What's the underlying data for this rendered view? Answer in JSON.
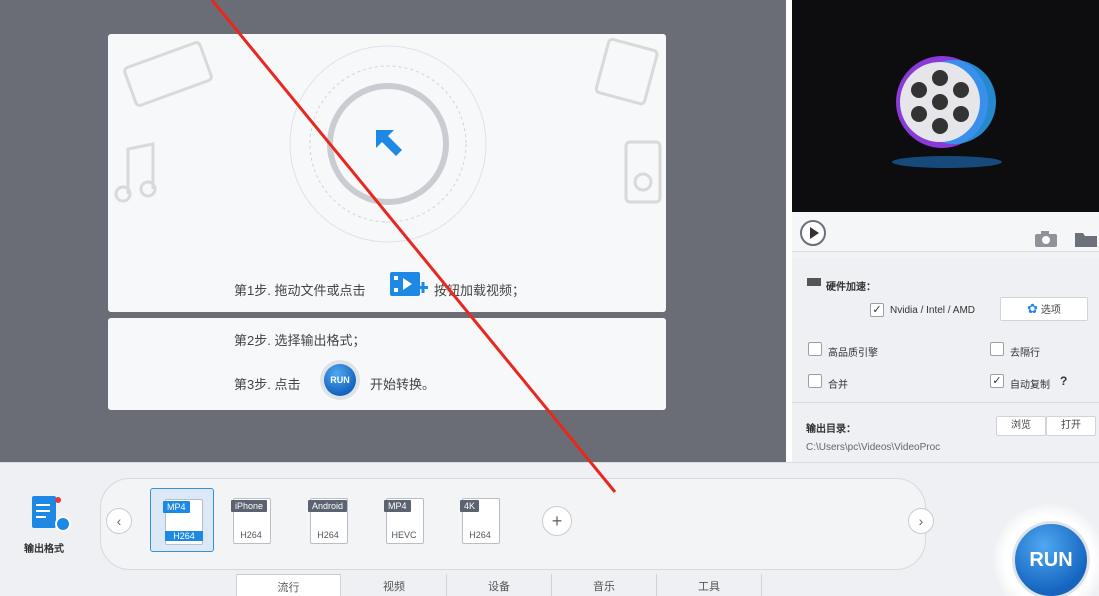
{
  "drop_area": {
    "step1_prefix": "第1步. 拖动文件或点击",
    "step1_suffix": "按钮加载视频；",
    "step2": "第2步. 选择输出格式；",
    "step3_prefix": "第3步. 点击",
    "step3_suffix": "开始转换。",
    "run_small_label": "RUN"
  },
  "preview": {
    "play_icon": "play-icon",
    "snapshot_icon": "camera-icon",
    "folder_icon": "folder-icon"
  },
  "settings": {
    "hw_accel_label": "硬件加速：",
    "hw_accel_option": "Nvidia / Intel / AMD",
    "hw_accel_checked": true,
    "options_button": "选项",
    "high_quality_label": "高品质引擎",
    "high_quality_checked": false,
    "deinterlace_label": "去隔行",
    "deinterlace_checked": false,
    "merge_label": "合并",
    "merge_checked": false,
    "auto_copy_label": "自动复制",
    "auto_copy_checked": true,
    "auto_copy_help": "?",
    "output_dir_label": "输出目录：",
    "output_path": "C:\\Users\\pc\\Videos\\VideoProc",
    "browse_button": "浏览",
    "open_button": "打开"
  },
  "bottom": {
    "output_format_label": "输出格式",
    "formats": [
      {
        "tag": "MP4",
        "codec": "H264",
        "selected": true
      },
      {
        "tag": "iPhone",
        "codec": "H264",
        "selected": false
      },
      {
        "tag": "Android",
        "codec": "H264",
        "selected": false
      },
      {
        "tag": "MP4",
        "codec": "HEVC",
        "selected": false
      },
      {
        "tag": "4K",
        "codec": "H264",
        "selected": false
      }
    ],
    "add_label": "+",
    "prev_arrow": "‹",
    "next_arrow": "›",
    "tabs": [
      "流行",
      "视频",
      "设备",
      "音乐",
      "工具"
    ],
    "active_tab": "流行",
    "run_label": "RUN"
  },
  "colors": {
    "accent": "#1e88e5",
    "annotation_red": "#e8281e",
    "drop_bg": "#6a6d76"
  }
}
